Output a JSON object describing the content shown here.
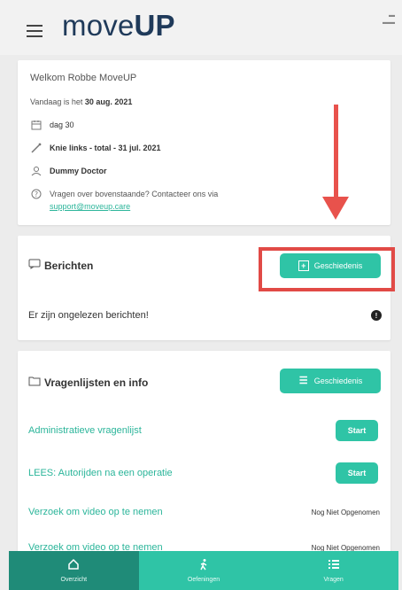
{
  "header": {
    "logo_light": "move",
    "logo_bold": "UP",
    "menu_icon": "hamburger-icon"
  },
  "summary": {
    "welcome": "Welkom Robbe MoveUP",
    "today_prefix": "Vandaag is het",
    "today_date": "30 aug. 2021",
    "day_label": "dag 30",
    "operation": "Knie links - total - 31 jul. 2021",
    "doctor": "Dummy Doctor",
    "question_text": "Vragen over bovenstaande? Contacteer ons via",
    "support_email": "support@moveup.care"
  },
  "messages": {
    "title": "Berichten",
    "history_button": "Geschiedenis",
    "unread_text": "Er zijn ongelezen berichten!"
  },
  "questionnaires": {
    "title": "Vragenlijsten en info",
    "history_button": "Geschiedenis",
    "items": [
      {
        "label": "Administratieve vragenlijst",
        "action": "Start"
      },
      {
        "label": "LEES: Autorijden na een operatie",
        "action": "Start"
      },
      {
        "label": "Verzoek om video op te nemen",
        "status": "Nog Niet Opgenomen"
      },
      {
        "label": "Verzoek om video op te nemen",
        "status": "Nog Niet Opgenomen"
      }
    ]
  },
  "nav": {
    "items": [
      {
        "label": "Overzicht",
        "icon": "home-icon",
        "active": true
      },
      {
        "label": "Oefeningen",
        "icon": "walking-icon",
        "active": false
      },
      {
        "label": "Vragen",
        "icon": "list-icon",
        "active": false
      }
    ]
  },
  "annotation": {
    "arrow_color": "#e8524c",
    "highlight_color": "#e14a46"
  },
  "colors": {
    "accent": "#2fc4a6",
    "accent_dark": "#1f8b78",
    "link": "#2bb59a",
    "logo": "#1f3a5a"
  }
}
